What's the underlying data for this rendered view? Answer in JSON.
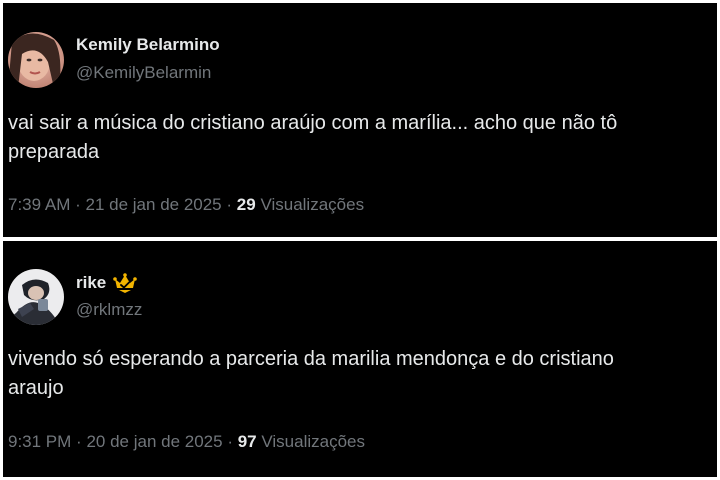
{
  "tweets": [
    {
      "display_name": "Kemily Belarmino",
      "handle": "@KemilyBelarmin",
      "text_lines": [
        "vai sair a música do cristiano araújo com a marília... acho que não tô",
        "preparada"
      ],
      "time": "7:39 AM",
      "separator": "·",
      "date": "21 de jan de 2025",
      "views_count": "29",
      "views_label": "Visualizações",
      "badge": null
    },
    {
      "display_name": "rike",
      "handle": "@rklmzz",
      "text_lines": [
        "vivendo só esperando a parceria da marilia mendonça e do cristiano",
        "araujo"
      ],
      "time": "9:31 PM",
      "separator": "·",
      "date": "20 de jan de 2025",
      "views_count": "97",
      "views_label": "Visualizações",
      "badge": "gold-crown-verified-icon"
    }
  ],
  "colors": {
    "background": "#000000",
    "text_primary": "#e7e9ea",
    "text_secondary": "#71767b",
    "badge_gold": "#f2b400"
  }
}
